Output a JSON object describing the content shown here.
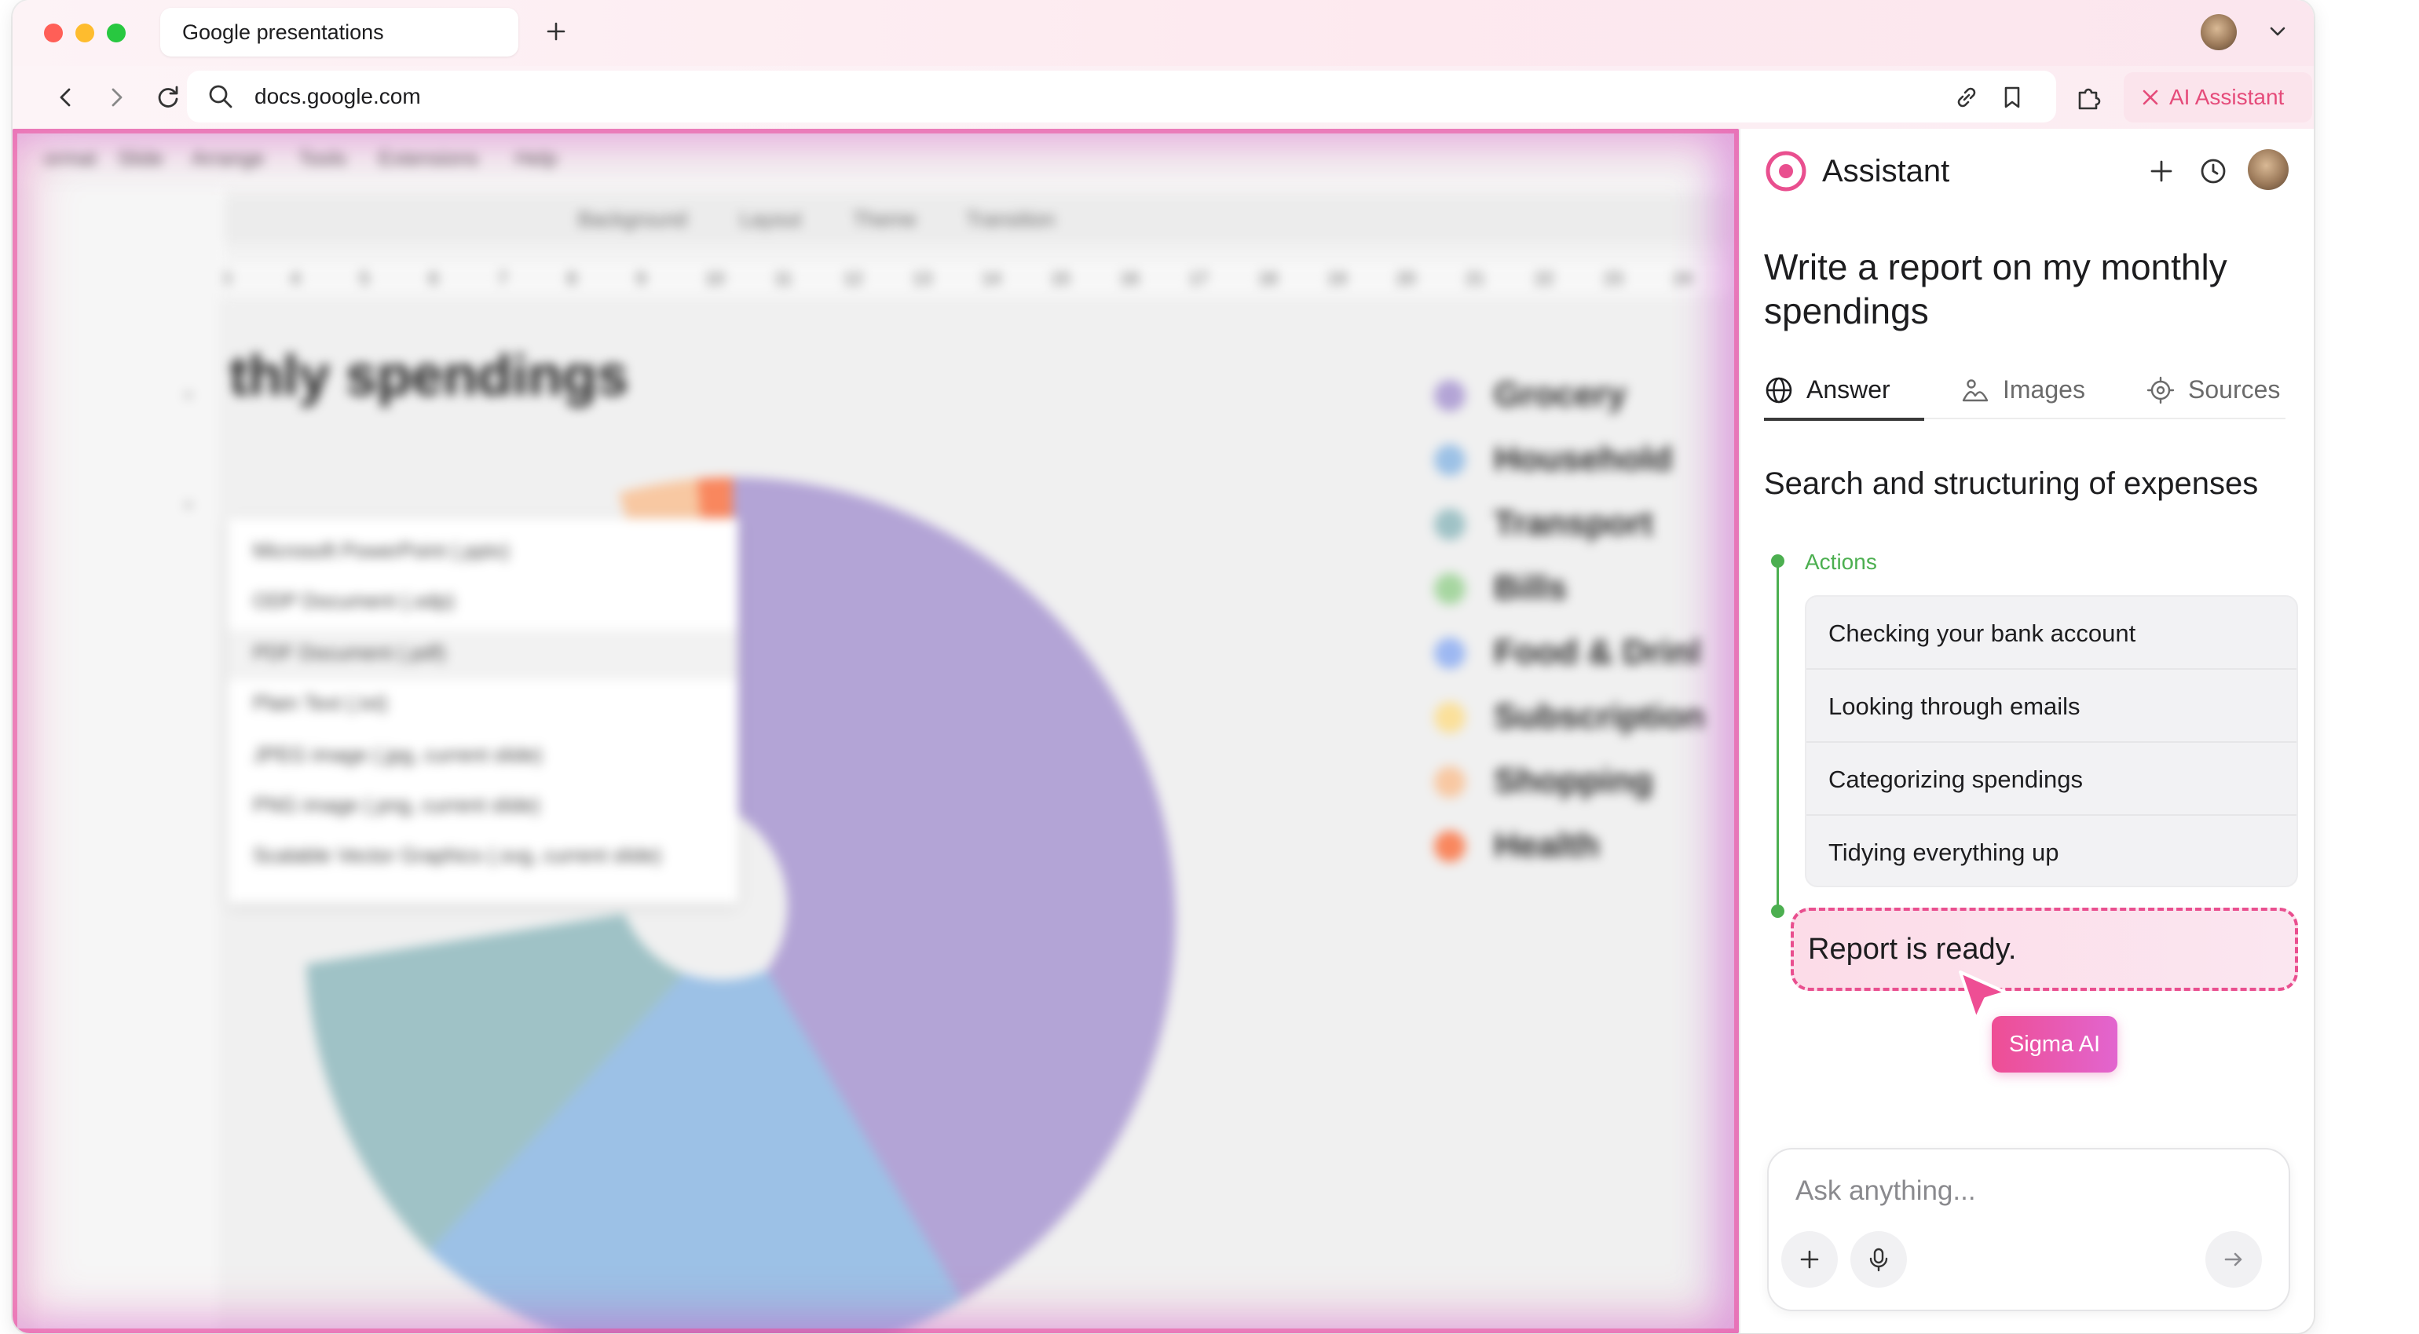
{
  "browser": {
    "tab_title": "Google presentations",
    "url": "docs.google.com",
    "ai_button_label": "AI Assistant"
  },
  "document": {
    "menu": [
      "ormat",
      "Slide",
      "Arrange",
      "Tools",
      "Extensions",
      "Help"
    ],
    "toolbar": [
      "Background",
      "Layout",
      "Theme",
      "Transition"
    ],
    "ruler": [
      "3",
      "4",
      "5",
      "6",
      "7",
      "8",
      "9",
      "10",
      "11",
      "12",
      "13",
      "14",
      "15",
      "16",
      "17",
      "18",
      "19",
      "20",
      "21",
      "22",
      "23",
      "24"
    ],
    "slide_title": "thly spendings",
    "export_menu": [
      "Microsoft PowerPoint (.pptx)",
      "ODP Document (.odp)",
      "PDF Document (.pdf)",
      "Plain Text (.txt)",
      "JPEG image (.jpg, current slide)",
      "PNG image (.png, current slide)",
      "Scalable Vector Graphics (.svg, current slide)"
    ],
    "legend": [
      {
        "label": "Grocery",
        "color": "#b3a4d6"
      },
      {
        "label": "Household",
        "color": "#9cc1e6"
      },
      {
        "label": "Transport",
        "color": "#9fc2c6"
      },
      {
        "label": "Bills",
        "color": "#a6d6a0"
      },
      {
        "label": "Food & Drinl",
        "color": "#9db8f2"
      },
      {
        "label": "Subscription",
        "color": "#fbe09a"
      },
      {
        "label": "Shopping",
        "color": "#f8c8a2"
      },
      {
        "label": "Health",
        "color": "#f9875e"
      }
    ]
  },
  "assistant": {
    "title": "Assistant",
    "query": "Write a report on my monthly spendings",
    "tabs": [
      {
        "label": "Answer",
        "icon": "globe-icon",
        "active": true
      },
      {
        "label": "Images",
        "icon": "images-icon",
        "active": false
      },
      {
        "label": "Sources",
        "icon": "sources-icon",
        "active": false
      }
    ],
    "section_title": "Search and structuring of expenses",
    "actions_label": "Actions",
    "actions": [
      "Checking your bank account",
      "Looking through emails",
      "Categorizing spendings",
      "Tidying everything up"
    ],
    "report_status": "Report is ready.",
    "cursor_tag": "Sigma AI",
    "input_placeholder": "Ask anything..."
  },
  "colors": {
    "accent_pink": "#e94f8f",
    "timeline_green": "#4caf50",
    "ai_button_text": "#e54b7a"
  }
}
